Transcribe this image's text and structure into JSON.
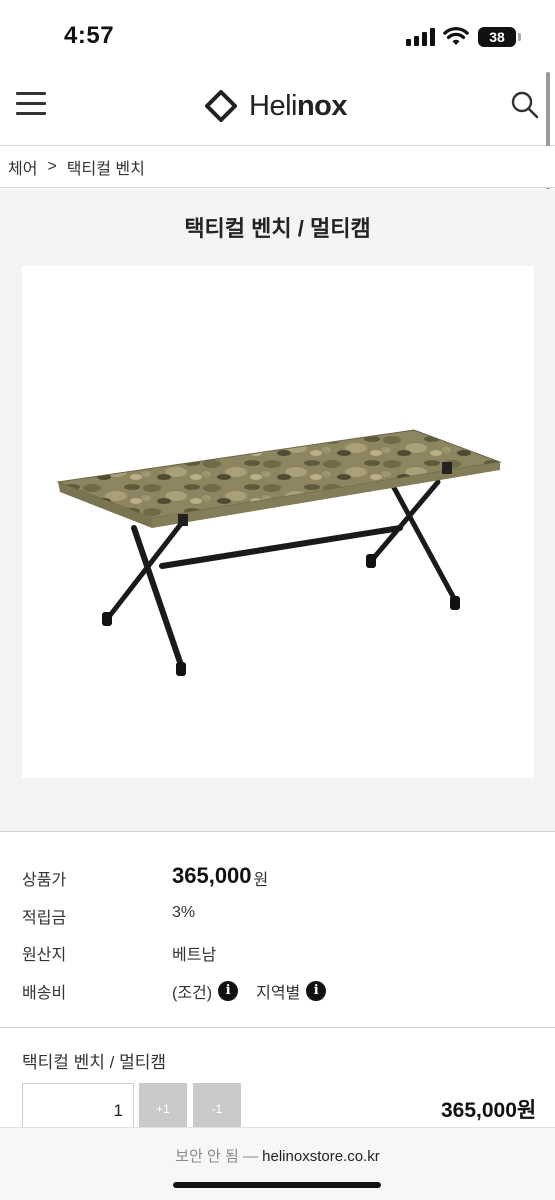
{
  "status_bar": {
    "time": "4:57",
    "battery_level": "38",
    "icons": [
      "signal-icon",
      "wifi-icon",
      "battery-icon"
    ]
  },
  "header": {
    "menu_icon": "hamburger-menu-icon",
    "logo_mark_icon": "helinox-diamond-logo-icon",
    "logo_text_light": "Heli",
    "logo_text_bold": "nox",
    "search_icon": "search-icon"
  },
  "breadcrumb": {
    "items": [
      "체어",
      "택티컬 벤치"
    ],
    "separator": ">"
  },
  "product": {
    "title": "택티컬 벤치 / 멀티캠",
    "image_alt": "multicam-camouflage-tactical-bench-image"
  },
  "info": {
    "rows": [
      {
        "label": "상품가",
        "value": "365,000",
        "unit": "원"
      },
      {
        "label": "적립금",
        "value": "3%"
      },
      {
        "label": "원산지",
        "value": "베트남"
      },
      {
        "label": "배송비",
        "value": "(조건)",
        "extra": "지역별"
      }
    ],
    "info_icon_glyph": "i"
  },
  "order": {
    "item_name": "택티컬 벤치 / 멀티캠",
    "quantity": "1",
    "plus_label": "+1",
    "minus_label": "-1",
    "total_price": "365,000원"
  },
  "browser": {
    "security_text": "보안 안 됨 —",
    "domain": "helinoxstore.co.kr"
  },
  "colors": {
    "background": "#f4f4f4",
    "text": "#222222",
    "button_gray": "#c9c9c9",
    "divider": "#d0d0d0"
  }
}
